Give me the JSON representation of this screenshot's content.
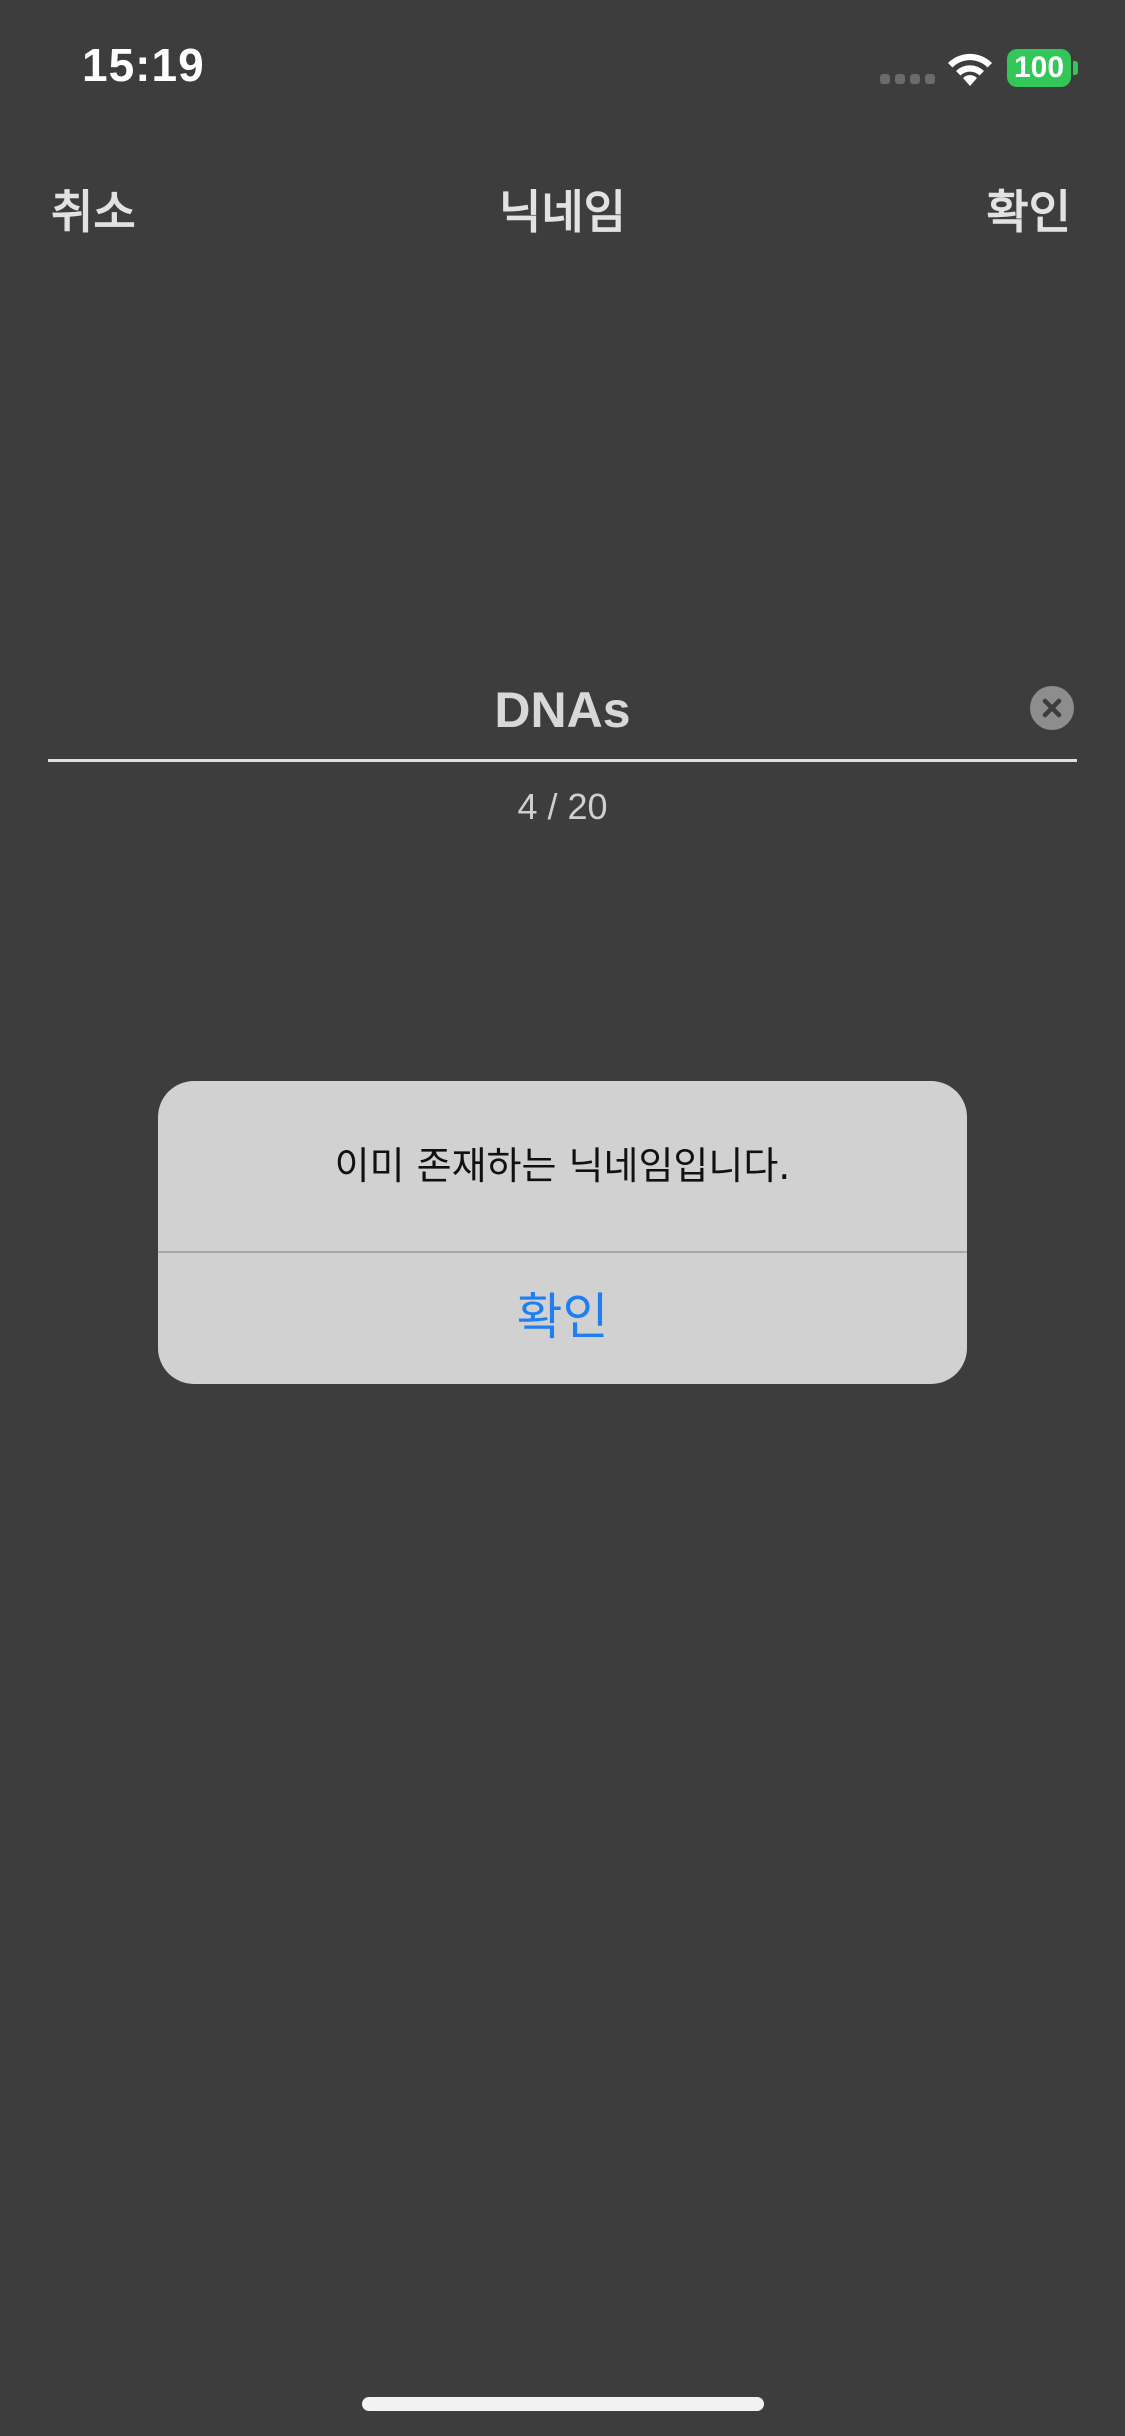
{
  "status_bar": {
    "time": "15:19",
    "battery_level": "100",
    "battery_color": "#32c758",
    "wifi_icon": "wifi-icon",
    "signal_icon": "cellular-signal-icon"
  },
  "nav": {
    "cancel_label": "취소",
    "title": "닉네임",
    "confirm_label": "확인"
  },
  "nickname": {
    "value": "DNAs",
    "counter": "4 / 20",
    "clear_icon": "clear-icon"
  },
  "alert": {
    "message": "이미 존재하는 닉네임입니다.",
    "button_label": "확인",
    "button_color": "#1f7ff0"
  },
  "colors": {
    "background": "#3d3d3d",
    "alert_background": "#d1d1d1"
  }
}
